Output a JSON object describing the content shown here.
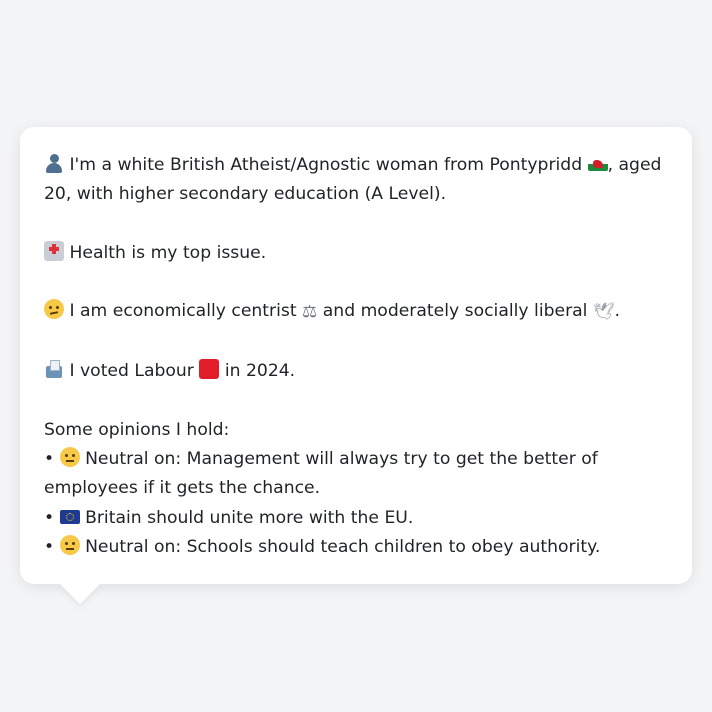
{
  "profile": {
    "line1": {
      "icon": "bust-in-silhouette-icon",
      "text_before_flag": "I'm a white British Atheist/Agnostic woman from Pontypridd",
      "flag_icon": "wales-flag-icon",
      "text_after_flag": ", aged 20, with higher secondary education (A Level)."
    },
    "line2": {
      "icon": "hospital-icon",
      "text": "Health is my top issue."
    },
    "line3": {
      "icon": "thinking-face-icon",
      "text_before_scales": "I am economically centrist",
      "scales_icon": "balance-scale-icon",
      "text_middle": "and moderately socially liberal",
      "dove_icon": "dove-icon",
      "text_end": "."
    },
    "line4": {
      "icon": "ballot-box-icon",
      "text_before_square": "I voted Labour",
      "square_icon": "red-square-icon",
      "text_after_square": "in 2024."
    },
    "opinions_heading": "Some opinions I hold:",
    "opinions": [
      {
        "bullet": "•",
        "icon": "neutral-face-icon",
        "text": "Neutral on: Management will always try to get the better of employees if it gets the chance."
      },
      {
        "bullet": "•",
        "icon": "eu-flag-icon",
        "text": "Britain should unite more with the EU."
      },
      {
        "bullet": "•",
        "icon": "neutral-face-icon",
        "text": "Neutral on: Schools should teach children to obey authority."
      }
    ]
  },
  "colors": {
    "background": "#f3f4f6",
    "bubble": "#ffffff",
    "text": "#1f2328",
    "labour_red": "#e11d2a"
  }
}
